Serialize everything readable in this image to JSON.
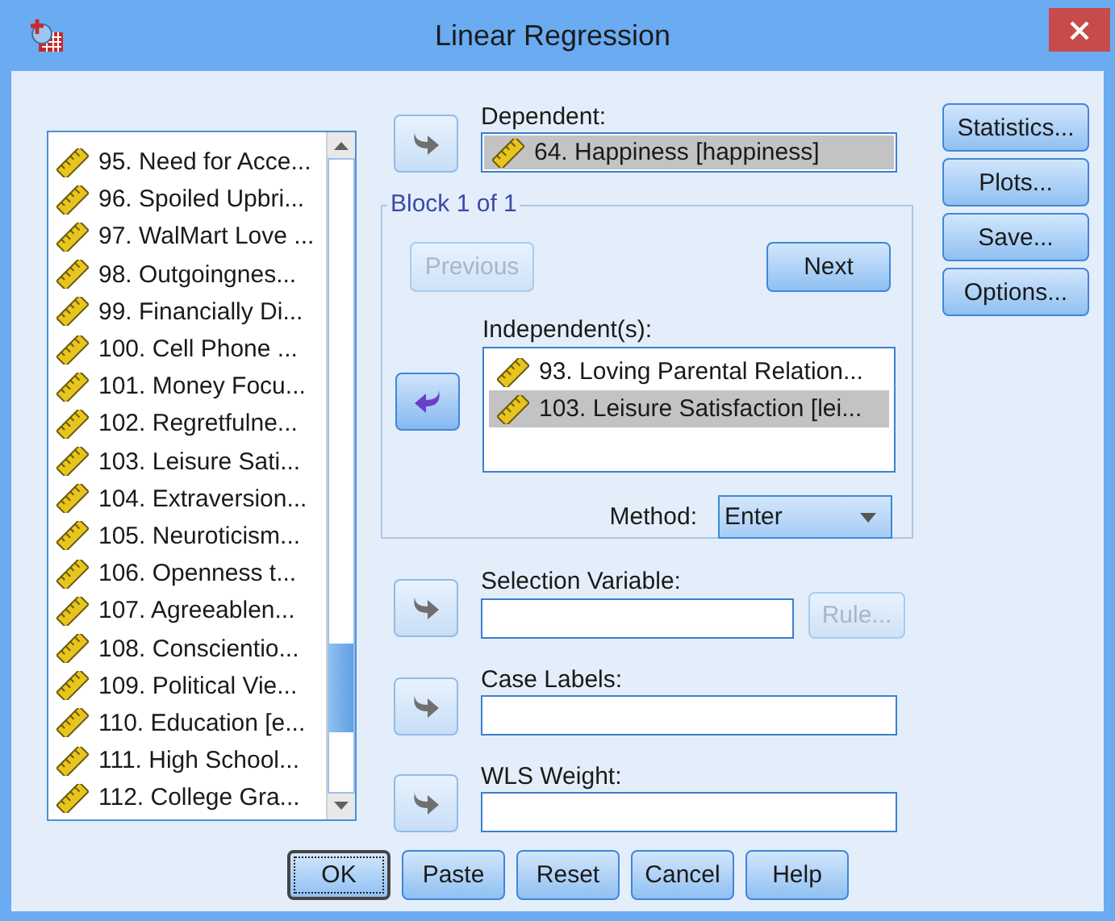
{
  "window": {
    "title": "Linear Regression"
  },
  "variables": [
    {
      "label": "95. Need for Acce...",
      "selected": false
    },
    {
      "label": "96. Spoiled Upbri...",
      "selected": false
    },
    {
      "label": "97. WalMart Love ...",
      "selected": false
    },
    {
      "label": "98. Outgoingnes...",
      "selected": false
    },
    {
      "label": "99. Financially Di...",
      "selected": false
    },
    {
      "label": "100. Cell Phone ...",
      "selected": false
    },
    {
      "label": "101. Money Focu...",
      "selected": false
    },
    {
      "label": "102. Regretfulne...",
      "selected": false
    },
    {
      "label": "103. Leisure Sati...",
      "selected": false
    },
    {
      "label": "104. Extraversion...",
      "selected": false
    },
    {
      "label": "105. Neuroticism...",
      "selected": false
    },
    {
      "label": "106. Openness t...",
      "selected": false
    },
    {
      "label": "107. Agreeablen...",
      "selected": false
    },
    {
      "label": "108. Conscientio...",
      "selected": false
    },
    {
      "label": "109. Political Vie...",
      "selected": false
    },
    {
      "label": "110. Education [e...",
      "selected": false
    },
    {
      "label": "111. High School...",
      "selected": false
    },
    {
      "label": "112. College Gra...",
      "selected": false
    }
  ],
  "dependent": {
    "label": "Dependent:",
    "arrow": {
      "kind": "right",
      "disabled": true
    },
    "items": [
      {
        "label": "64. Happiness [happiness]",
        "selected": true
      }
    ]
  },
  "block": {
    "title": "Block 1 of 1",
    "previous": {
      "label": "Previous",
      "disabled": true
    },
    "next": {
      "label": "Next",
      "disabled": false
    },
    "independents": {
      "label": "Independent(s):",
      "arrow": {
        "kind": "left",
        "disabled": false
      },
      "items": [
        {
          "label": "93. Loving Parental Relation...",
          "selected": false
        },
        {
          "label": "103. Leisure Satisfaction [lei...",
          "selected": true
        }
      ]
    },
    "method": {
      "label": "Method:",
      "value": "Enter"
    }
  },
  "selection_variable": {
    "label": "Selection Variable:",
    "arrow": {
      "kind": "right",
      "disabled": true
    },
    "rule": {
      "label": "Rule...",
      "disabled": true
    }
  },
  "case_labels": {
    "label": "Case Labels:",
    "arrow": {
      "kind": "right",
      "disabled": true
    }
  },
  "wls_weight": {
    "label": "WLS Weight:",
    "arrow": {
      "kind": "right",
      "disabled": true
    }
  },
  "side_buttons": [
    {
      "label": "Statistics..."
    },
    {
      "label": "Plots..."
    },
    {
      "label": "Save..."
    },
    {
      "label": "Options..."
    }
  ],
  "buttons": [
    {
      "label": "OK",
      "focused": true
    },
    {
      "label": "Paste",
      "focused": false
    },
    {
      "label": "Reset",
      "focused": false
    },
    {
      "label": "Cancel",
      "focused": false
    },
    {
      "label": "Help",
      "focused": false
    }
  ]
}
